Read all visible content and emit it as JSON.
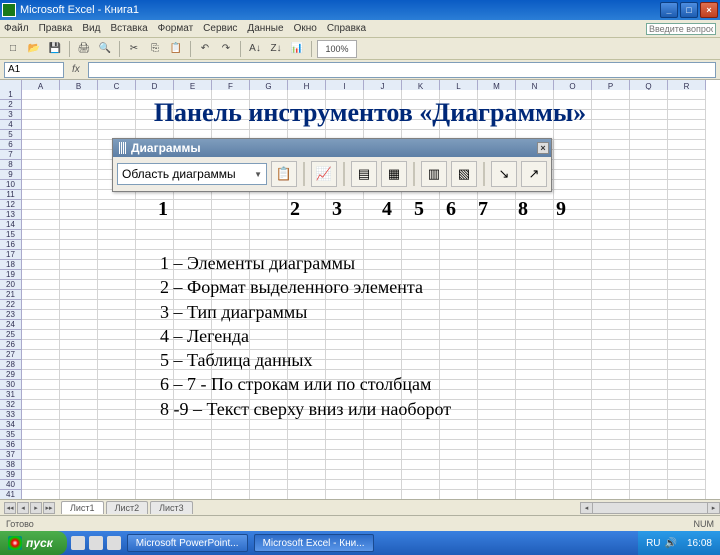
{
  "window": {
    "title": "Microsoft Excel - Книга1",
    "min": "_",
    "max": "□",
    "close": "×"
  },
  "menu": {
    "items": [
      "Файл",
      "Правка",
      "Вид",
      "Вставка",
      "Формат",
      "Сервис",
      "Данные",
      "Окно",
      "Справка"
    ],
    "question_label": "Введите вопрос"
  },
  "namebox": "A1",
  "columns": [
    "A",
    "B",
    "C",
    "D",
    "E",
    "F",
    "G",
    "H",
    "I",
    "J",
    "K",
    "L",
    "M",
    "N",
    "O",
    "P",
    "Q",
    "R"
  ],
  "slide": {
    "title": "Панель инструментов «Диаграммы»"
  },
  "chart_toolbar": {
    "title": "Диаграммы",
    "combo_value": "Область диаграммы",
    "close": "×",
    "buttons": [
      {
        "name": "format-object",
        "glyph": "📋"
      },
      {
        "name": "chart-type",
        "glyph": "📈"
      },
      {
        "name": "legend",
        "glyph": "▤"
      },
      {
        "name": "data-table",
        "glyph": "▦"
      },
      {
        "name": "by-row",
        "glyph": "▥"
      },
      {
        "name": "by-column",
        "glyph": "▧"
      },
      {
        "name": "angle-down",
        "glyph": "↘"
      },
      {
        "name": "angle-up",
        "glyph": "↗"
      }
    ]
  },
  "annotations": {
    "numbers": [
      "1",
      "2",
      "3",
      "4",
      "5",
      "6",
      "7",
      "8",
      "9"
    ]
  },
  "legend_lines": [
    "1 – Элементы диаграммы",
    "2 – Формат выделенного элемента",
    "3 – Тип диаграммы",
    "4 – Легенда",
    "5 – Таблица данных",
    "6 – 7  - По строкам или по столбцам",
    "8 -9 – Текст сверху вниз или наоборот"
  ],
  "tabs": {
    "nav": [
      "◂◂",
      "◂",
      "▸",
      "▸▸"
    ],
    "sheets": [
      "Лист1",
      "Лист2",
      "Лист3"
    ]
  },
  "status": "Готово",
  "caps": "NUM",
  "taskbar": {
    "start": "пуск",
    "items": [
      "Microsoft PowerPoint...",
      "Microsoft Excel - Кни..."
    ],
    "tray": {
      "lang": "RU",
      "clock": "16:08"
    }
  }
}
